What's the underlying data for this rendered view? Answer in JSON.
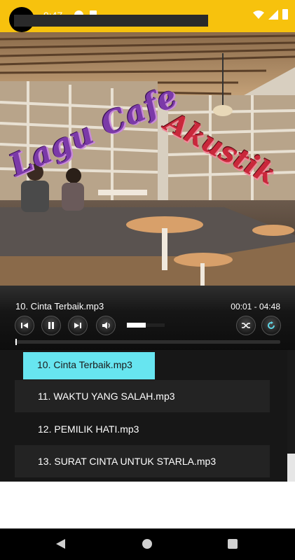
{
  "status_bar": {
    "time": "9:47"
  },
  "cover": {
    "title_line1": "Lagu Cafe",
    "title_line2": "Akustik"
  },
  "player": {
    "now_playing": "10. Cinta Terbaik.mp3",
    "time": "00:01 - 04:48",
    "progress": 0.003,
    "volume": 0.5
  },
  "playlist": [
    {
      "label": "10. Cinta Terbaik.mp3",
      "active": true
    },
    {
      "label": "11. WAKTU YANG SALAH.mp3"
    },
    {
      "label": "12. PEMILIK HATI.mp3"
    },
    {
      "label": "13. SURAT CINTA UNTUK STARLA.mp3"
    }
  ],
  "colors": {
    "status": "#f7c20d",
    "highlight": "#67e5f0"
  },
  "icons": [
    "previous-icon",
    "pause-icon",
    "next-icon",
    "volume-icon",
    "shuffle-icon",
    "repeat-icon",
    "back-icon",
    "home-icon",
    "recents-icon"
  ]
}
